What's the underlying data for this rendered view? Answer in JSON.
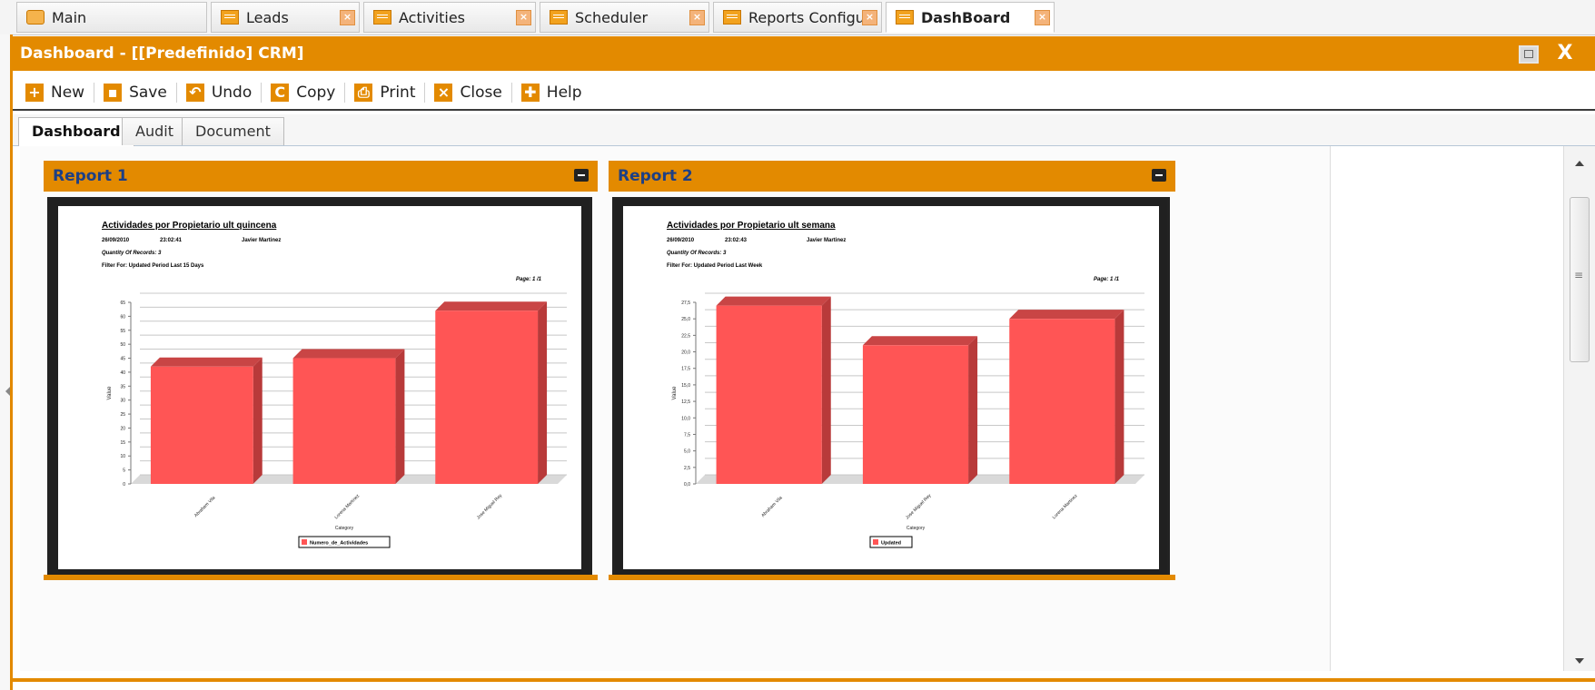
{
  "top_tabs": [
    {
      "label": "Main"
    },
    {
      "label": "Leads"
    },
    {
      "label": "Activities"
    },
    {
      "label": "Scheduler"
    },
    {
      "label": "Reports Configurato"
    },
    {
      "label": "DashBoard"
    }
  ],
  "window": {
    "title": "Dashboard - [[Predefinido] CRM]"
  },
  "toolbar": {
    "new_label": "New",
    "save_label": "Save",
    "undo_label": "Undo",
    "copy_label": "Copy",
    "print_label": "Print",
    "close_label": "Close",
    "help_label": "Help"
  },
  "subtabs": [
    {
      "label": "Dashboard"
    },
    {
      "label": "Audit"
    },
    {
      "label": "Document"
    }
  ],
  "reports": [
    {
      "title": "Report 1",
      "doc_title": "Actividades por Propietario ult quincena",
      "date": "26/09/2010",
      "time": "23:02:41",
      "owner": "Javier Martinez",
      "records": "Quantity Of Records: 3",
      "filter": "Filter For:  Updated Period Last 15 Days",
      "page": "Page: 1 /1"
    },
    {
      "title": "Report 2",
      "doc_title": "Actividades por Propietario ult semana",
      "date": "26/09/2010",
      "time": "23:02:43",
      "owner": "Javier Martinez",
      "records": "Quantity Of Records: 3",
      "filter": "Filter For:  Updated Period Last Week",
      "page": "Page: 1 /1"
    }
  ],
  "colors": {
    "accent": "#e38a00",
    "bar": "#ff5555",
    "bar_dark": "#b83a3a",
    "title_blue": "#1d3f85"
  },
  "chart_data": [
    {
      "type": "bar",
      "categories": [
        "Abraham Vila",
        "Lorena Martinez",
        "Jose Miguel Rey"
      ],
      "series": [
        {
          "name": "Numero_de_Actividades",
          "values": [
            42,
            45,
            62
          ]
        }
      ],
      "xlabel": "Category",
      "ylabel": "Value",
      "ylim": [
        0,
        65
      ],
      "yticks": [
        "0",
        "5",
        "10",
        "15",
        "20",
        "25",
        "30",
        "35",
        "40",
        "45",
        "50",
        "55",
        "60",
        "65"
      ],
      "grid": true,
      "legend": "bottom"
    },
    {
      "type": "bar",
      "categories": [
        "Abraham Vila",
        "Jose Miguel Rey",
        "Lorena Martinez"
      ],
      "series": [
        {
          "name": "Updated",
          "values": [
            27,
            21,
            25
          ]
        }
      ],
      "xlabel": "Category",
      "ylabel": "Value",
      "ylim": [
        0,
        27.5
      ],
      "yticks": [
        "0,0",
        "2,5",
        "5,0",
        "7,5",
        "10,0",
        "12,5",
        "15,0",
        "17,5",
        "20,0",
        "22,5",
        "25,0",
        "27,5"
      ],
      "grid": true,
      "legend": "bottom"
    }
  ]
}
